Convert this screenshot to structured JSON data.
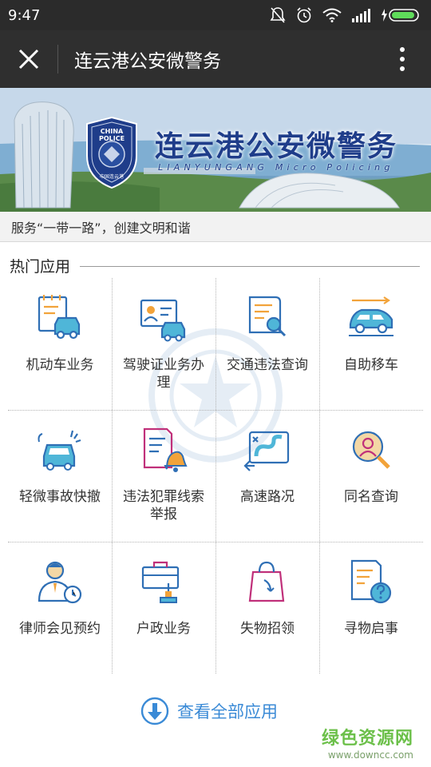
{
  "status_bar": {
    "time": "9:47"
  },
  "header": {
    "title": "连云港公安微警务"
  },
  "banner": {
    "badge_text": "CHINA POLICE",
    "badge_sub": "中国连云港",
    "title": "连云港公安微警务",
    "subtitle": "LIANYUNGANG Micro Policing"
  },
  "slogan": "服务“一带一路”，创建文明和谐",
  "section": {
    "title": "热门应用"
  },
  "apps": [
    {
      "label": "机动车业务",
      "icon": "vehicle-business-icon"
    },
    {
      "label": "驾驶证业务办理",
      "icon": "driver-license-icon"
    },
    {
      "label": "交通违法查询",
      "icon": "traffic-violation-query-icon"
    },
    {
      "label": "自助移车",
      "icon": "self-service-car-move-icon"
    },
    {
      "label": "轻微事故快撤",
      "icon": "minor-accident-icon"
    },
    {
      "label": "违法犯罪线索举报",
      "icon": "crime-report-icon"
    },
    {
      "label": "高速路况",
      "icon": "highway-conditions-icon"
    },
    {
      "label": "同名查询",
      "icon": "same-name-query-icon"
    },
    {
      "label": "律师会见预约",
      "icon": "lawyer-appointment-icon"
    },
    {
      "label": "户政业务",
      "icon": "household-registration-icon"
    },
    {
      "label": "失物招领",
      "icon": "lost-and-found-icon"
    },
    {
      "label": "寻物启事",
      "icon": "lost-item-notice-icon"
    }
  ],
  "footer": {
    "view_all": "查看全部应用"
  },
  "watermark": {
    "site_name": "绿色资源网",
    "site_url": "www.downcc.com"
  },
  "colors": {
    "accent": "#3a8ad6",
    "icon_blue": "#2f6fb5",
    "icon_orange": "#f2a33a",
    "icon_cyan": "#4fb6d8",
    "site_green": "#6cc04a"
  }
}
